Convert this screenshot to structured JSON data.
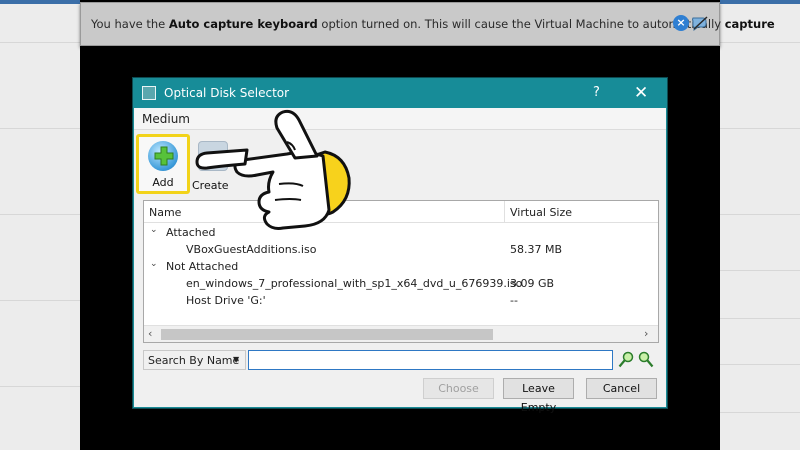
{
  "banner": {
    "prefix": "You have the ",
    "bold1": "Auto capture keyboard",
    "middle": " option turned on. This will cause the Virtual Machine to automatically ",
    "bold2": "capture"
  },
  "dialog": {
    "title": "Optical Disk Selector",
    "help": "?",
    "close": "✕",
    "menu": "Medium",
    "toolbar": {
      "add_label": "Add",
      "create_label": "Create"
    },
    "table": {
      "col_name": "Name",
      "col_size": "Virtual Size",
      "rows": [
        {
          "label": "Attached",
          "size": "",
          "group": true
        },
        {
          "label": "VBoxGuestAdditions.iso",
          "size": "58.37 MB",
          "group": false
        },
        {
          "label": "Not Attached",
          "size": "",
          "group": true
        },
        {
          "label": "en_windows_7_professional_with_sp1_x64_dvd_u_676939.iso",
          "size": "3.09 GB",
          "group": false
        },
        {
          "label": "Host Drive 'G:'",
          "size": "--",
          "group": false
        }
      ]
    },
    "search": {
      "mode": "Search By Name",
      "value": ""
    },
    "buttons": {
      "choose": "Choose",
      "leave_empty": "Leave Empty",
      "cancel": "Cancel"
    }
  },
  "colors": {
    "titlebar": "#178c98",
    "highlight": "#f2d31a"
  }
}
